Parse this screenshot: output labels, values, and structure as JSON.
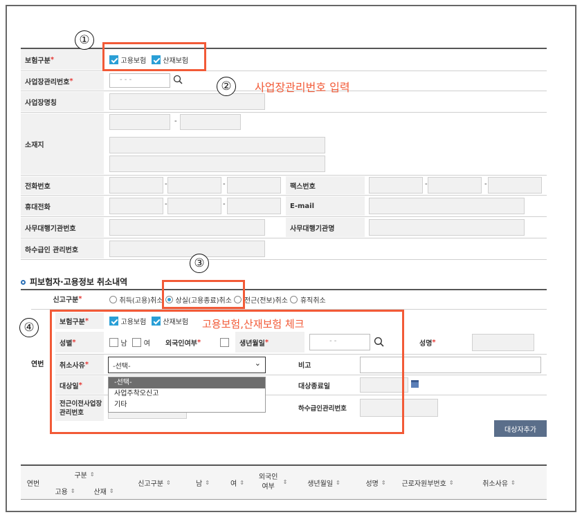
{
  "form": {
    "insurance_type_label": "보험구분",
    "employment_insurance": "고용보험",
    "accident_insurance": "산재보험",
    "workplace_no_label": "사업장관리번호",
    "workplace_no_value": "- -  -",
    "workplace_name_label": "사업장명칭",
    "address_label": "소재지",
    "phone_label": "전화번호",
    "fax_label": "팩스번호",
    "mobile_label": "휴대전화",
    "email_label": "E-mail",
    "agency_no_label": "사무대행기관번호",
    "agency_name_label": "사무대행기관명",
    "subcontract_no_label": "하수급인 관리번호"
  },
  "annotations": {
    "n1": "①",
    "n2": "②",
    "n3": "③",
    "n4": "④",
    "text2": "사업장관리번호 입력",
    "text4": "고용보험,산재보험 체크"
  },
  "section": {
    "title": "피보험자·고용정보 취소내역",
    "report_type_label": "신고구분",
    "options": [
      "취득(고용)취소",
      "상실(고용종료)취소",
      "전근(전보)취소",
      "휴직취소"
    ],
    "insurance_type_label": "보험구분",
    "employment_insurance": "고용보험",
    "accident_insurance": "산재보험",
    "gender_label": "성별",
    "male": "남",
    "female": "여",
    "foreigner_label": "외국인여부",
    "birth_label": "생년월일",
    "birth_value": "- -",
    "name_label": "성명",
    "row_label": "연번",
    "cancel_reason_label": "취소사유",
    "cancel_reason_value": "-선택-",
    "remark_label": "비고",
    "target_date_label": "대상일",
    "target_end_label": "대상종료일",
    "prev_workplace_label": "전근이전사업장 관리번호",
    "subcontract_label": "하수급인관리번호",
    "dropdown_options": [
      "-선택-",
      "사업주착오신고",
      "기타"
    ],
    "add_button": "대상자추가"
  },
  "table": {
    "headers": {
      "row": "연번",
      "group": "구분",
      "employment": "고용",
      "accident": "산재",
      "report": "신고구분",
      "male": "남",
      "female": "여",
      "foreigner": "외국인여부",
      "birth": "생년월일",
      "name": "성명",
      "worker_no": "근로자원부번호",
      "reason": "취소사유"
    }
  }
}
